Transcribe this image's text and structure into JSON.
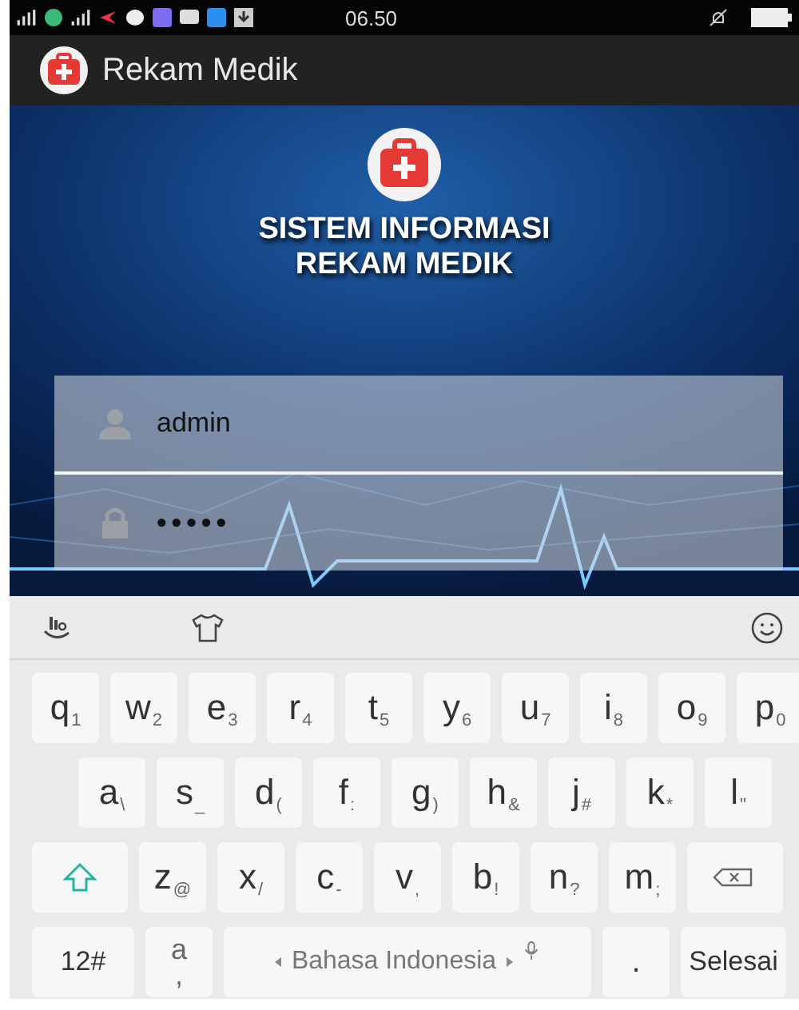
{
  "status_bar": {
    "time": "06.50"
  },
  "app_bar": {
    "title": "Rekam Medik"
  },
  "login": {
    "heading": [
      "SISTEM INFORMASI",
      "REKAM MEDIK"
    ],
    "fields": [
      {
        "kind": "username",
        "value": "admin"
      },
      {
        "kind": "password",
        "value": "•••••"
      }
    ]
  },
  "keyboard": {
    "rows": [
      {
        "keys": [
          {
            "kind": "letter",
            "label": "q",
            "sub": "1"
          },
          {
            "kind": "letter",
            "label": "w",
            "sub": "2"
          },
          {
            "kind": "letter",
            "label": "e",
            "sub": "3"
          },
          {
            "kind": "letter",
            "label": "r",
            "sub": "4"
          },
          {
            "kind": "letter",
            "label": "t",
            "sub": "5"
          },
          {
            "kind": "letter",
            "label": "y",
            "sub": "6"
          },
          {
            "kind": "letter",
            "label": "u",
            "sub": "7"
          },
          {
            "kind": "letter",
            "label": "i",
            "sub": "8"
          },
          {
            "kind": "letter",
            "label": "o",
            "sub": "9"
          },
          {
            "kind": "letter",
            "label": "p",
            "sub": "0"
          }
        ]
      },
      {
        "keys": [
          {
            "kind": "letter",
            "label": "a",
            "sub": "\\"
          },
          {
            "kind": "letter",
            "label": "s",
            "sub": "_"
          },
          {
            "kind": "letter",
            "label": "d",
            "sub": "("
          },
          {
            "kind": "letter",
            "label": "f",
            "sub": ":"
          },
          {
            "kind": "letter",
            "label": "g",
            "sub": ")"
          },
          {
            "kind": "letter",
            "label": "h",
            "sub": "&"
          },
          {
            "kind": "letter",
            "label": "j",
            "sub": "#"
          },
          {
            "kind": "letter",
            "label": "k",
            "sub": "*"
          },
          {
            "kind": "letter",
            "label": "l",
            "sub": "\""
          }
        ]
      },
      {
        "keys": [
          {
            "kind": "shift"
          },
          {
            "kind": "letter",
            "label": "z",
            "sub": "@"
          },
          {
            "kind": "letter",
            "label": "x",
            "sub": "/"
          },
          {
            "kind": "letter",
            "label": "c",
            "sub": "-"
          },
          {
            "kind": "letter",
            "label": "v",
            "sub": ","
          },
          {
            "kind": "letter",
            "label": "b",
            "sub": "!"
          },
          {
            "kind": "letter",
            "label": "n",
            "sub": "?"
          },
          {
            "kind": "letter",
            "label": "m",
            "sub": ";"
          },
          {
            "kind": "backspace"
          }
        ]
      },
      {
        "keys": [
          {
            "kind": "wide",
            "label": "12#"
          },
          {
            "kind": "stacked",
            "top": "a",
            "label": ","
          },
          {
            "kind": "space",
            "label": "Bahasa Indonesia"
          },
          {
            "kind": "plain",
            "label": "."
          },
          {
            "kind": "wide",
            "label": "Selesai"
          }
        ]
      }
    ]
  }
}
